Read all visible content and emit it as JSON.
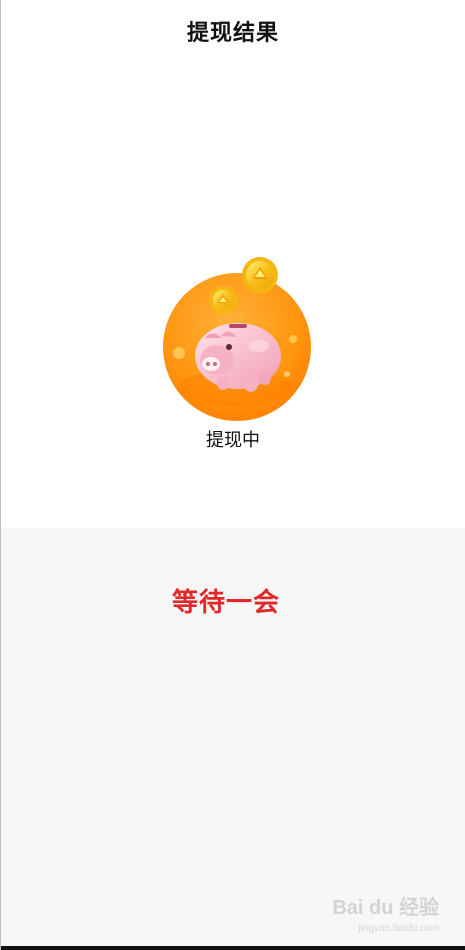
{
  "header": {
    "title": "提现结果"
  },
  "main": {
    "illustration_icon": "piggy-bank-with-coins-icon",
    "status_text": "提现中"
  },
  "lower_panel": {
    "message": "等待一会"
  },
  "watermark": {
    "text": "Bai du 经验",
    "sub_text": "jingyan.baidu.com"
  },
  "colors": {
    "background": "#ffffff",
    "panel_background": "#f7f7f7",
    "accent_orange": "#ff9800",
    "wait_red": "#e12727",
    "coin_gold": "#f7c11d",
    "pig_pink": "#f7b9c9"
  }
}
